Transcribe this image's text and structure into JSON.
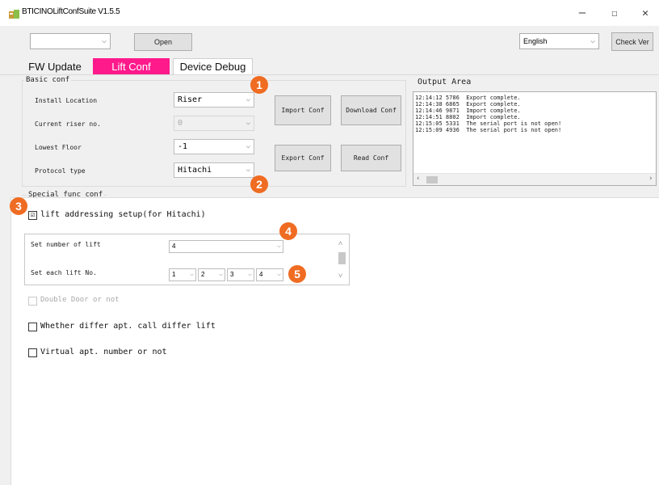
{
  "window": {
    "title": "BTICINOLiftConfSuite V1.5.5",
    "minimize": "–",
    "maximize": "☐",
    "close": "✕"
  },
  "toolbar": {
    "port_value": "",
    "open_label": "Open",
    "language_value": "English",
    "check_ver_label": "Check Ver"
  },
  "tabs": [
    {
      "label": "FW Update"
    },
    {
      "label": "Lift Conf"
    },
    {
      "label": "Device Debug"
    }
  ],
  "basic_conf": {
    "title": "Basic conf",
    "install_location_label": "Install Location",
    "install_location_value": "Riser",
    "current_riser_label": "Current riser no.",
    "current_riser_value": "0",
    "lowest_floor_label": "Lowest Floor",
    "lowest_floor_value": "-1",
    "protocol_type_label": "Protocol type",
    "protocol_type_value": "Hitachi",
    "import_conf": "Import Conf",
    "download_conf": "Download Conf",
    "export_conf": "Export Conf",
    "read_conf": "Read Conf"
  },
  "output": {
    "title": "Output Area",
    "lines": [
      "12:14:12 5786  Export complete.",
      "12:14:38 6865  Export complete.",
      "12:14:46 9871  Import complete.",
      "12:14:51 8802  Import complete.",
      "12:15:05 5331  The serial port is not open!",
      "12:15:09 4936  The serial port is not open!"
    ]
  },
  "special": {
    "title": "Special func conf",
    "lift_addressing_label": "lift addressing setup(for Hitachi)",
    "lift_addressing_checked": "☑",
    "set_number_label": "Set number of lift",
    "set_number_value": "4",
    "set_each_label": "Set each lift No.",
    "lift_numbers": [
      "1",
      "2",
      "3",
      "4"
    ],
    "double_door_label": "Double Door or not",
    "differ_lift_label": "Whether differ apt. call differ lift",
    "virtual_apt_label": "Virtual apt. number or not"
  },
  "markers": [
    "1",
    "2",
    "3",
    "4",
    "5"
  ],
  "colors": {
    "active_tab": "#ff1a8c",
    "marker": "#ef6c22"
  }
}
